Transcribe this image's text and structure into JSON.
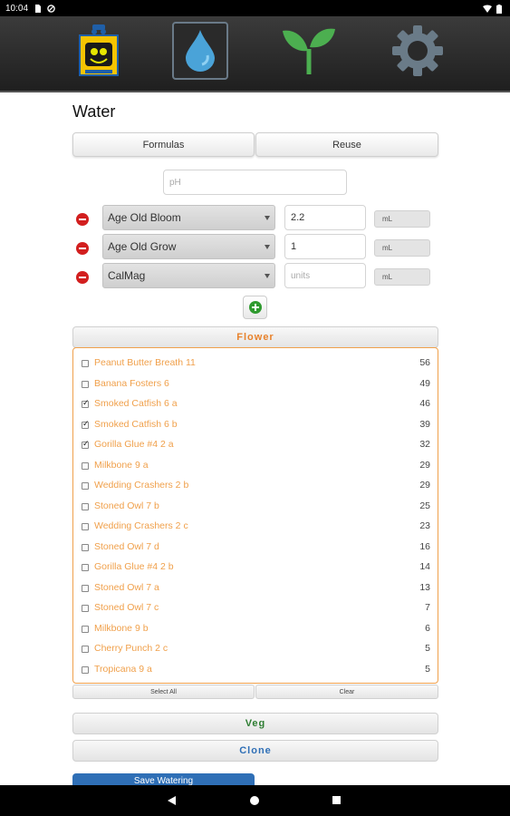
{
  "status_bar": {
    "time": "10:04"
  },
  "nav": {
    "items": [
      {
        "icon": "robot-icon"
      },
      {
        "icon": "water-drop-icon",
        "active": true
      },
      {
        "icon": "sprout-icon"
      },
      {
        "icon": "gear-icon"
      }
    ]
  },
  "page": {
    "title": "Water"
  },
  "tabs": {
    "formulas": "Formulas",
    "reuse": "Reuse"
  },
  "ph": {
    "placeholder": "pH"
  },
  "nutrients": [
    {
      "name": "Age Old Bloom",
      "amount": "2.2",
      "unit": "mL"
    },
    {
      "name": "Age Old Grow",
      "amount": "1",
      "unit": "mL"
    },
    {
      "name": "CalMag",
      "amount": "",
      "amount_placeholder": "units",
      "unit": "mL"
    }
  ],
  "groups": {
    "flower": "Flower",
    "veg": "Veg",
    "clone": "Clone"
  },
  "plants": [
    {
      "name": "Peanut Butter Breath 11",
      "count": "56",
      "checked": false
    },
    {
      "name": "Banana Fosters 6",
      "count": "49",
      "checked": false
    },
    {
      "name": "Smoked Catfish 6 a",
      "count": "46",
      "checked": true
    },
    {
      "name": "Smoked Catfish 6 b",
      "count": "39",
      "checked": true
    },
    {
      "name": "Gorilla Glue #4 2 a",
      "count": "32",
      "checked": true
    },
    {
      "name": "Milkbone 9 a",
      "count": "29",
      "checked": false
    },
    {
      "name": "Wedding Crashers 2 b",
      "count": "29",
      "checked": false
    },
    {
      "name": "Stoned Owl 7 b",
      "count": "25",
      "checked": false
    },
    {
      "name": "Wedding Crashers 2 c",
      "count": "23",
      "checked": false
    },
    {
      "name": "Stoned Owl 7 d",
      "count": "16",
      "checked": false
    },
    {
      "name": "Gorilla Glue #4 2 b",
      "count": "14",
      "checked": false
    },
    {
      "name": "Stoned Owl 7 a",
      "count": "13",
      "checked": false
    },
    {
      "name": "Stoned Owl 7 c",
      "count": "7",
      "checked": false
    },
    {
      "name": "Milkbone 9 b",
      "count": "6",
      "checked": false
    },
    {
      "name": "Cherry Punch 2 c",
      "count": "5",
      "checked": false
    },
    {
      "name": "Tropicana 9 a",
      "count": "5",
      "checked": false
    }
  ],
  "list_actions": {
    "select_all": "Select All",
    "clear": "Clear"
  },
  "save": {
    "label": "Save Watering"
  },
  "colors": {
    "accent_orange": "#f0a04b",
    "veg_green": "#2e7d32",
    "clone_blue": "#2f6fb6",
    "flower_orange": "#e8822c",
    "remove_red": "#d21f1f"
  }
}
